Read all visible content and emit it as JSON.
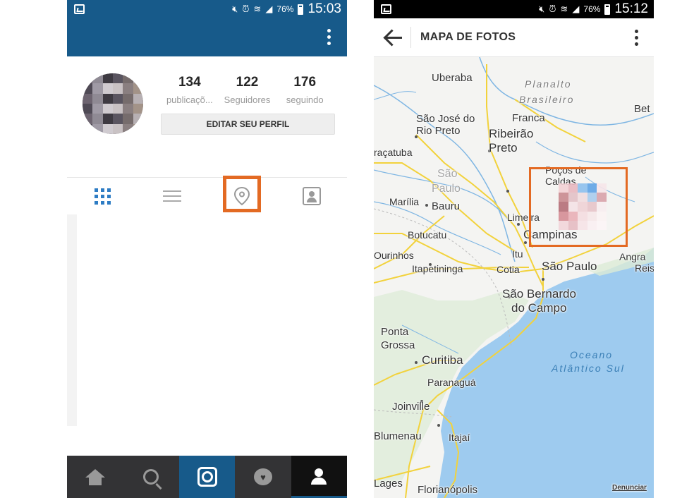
{
  "left_screen": {
    "status": {
      "battery": "76%",
      "time": "15:03"
    },
    "profile": {
      "stats": [
        {
          "value": "134",
          "label": "publicaçõ..."
        },
        {
          "value": "122",
          "label": "Seguidores"
        },
        {
          "value": "176",
          "label": "seguindo"
        }
      ],
      "edit_button": "EDITAR SEU PERFIL"
    },
    "tabs": [
      "grid-icon",
      "list-icon",
      "location-pin-icon",
      "tagged-photos-icon"
    ],
    "selected_tab": "location-pin-icon",
    "bottom_nav": [
      "home-icon",
      "search-icon",
      "camera-icon",
      "activity-icon",
      "profile-icon"
    ],
    "active_nav": "profile-icon",
    "colors": {
      "header": "#175a8a",
      "accent": "#2d7cc4",
      "highlight": "#e36a23"
    }
  },
  "right_screen": {
    "status": {
      "battery": "76%",
      "time": "15:12"
    },
    "title": "MAPA DE FOTOS",
    "map_labels": {
      "uberaba": "Uberaba",
      "planalto": "Planalto",
      "brasileiro": "Brasileiro",
      "franca": "Franca",
      "bet": "Bet",
      "sao_jose": "São José do",
      "rio_preto": "Rio Preto",
      "ribeirao": "Ribeirão",
      "preto": "Preto",
      "aracatuba": "raçatuba",
      "sao_paulo_state": "São",
      "paulo_state": "Paulo",
      "pocos": "Poços de",
      "caldas": "Caldas",
      "marilia": "Marília",
      "bauru": "Bauru",
      "limeira": "Limeira",
      "campinas": "Campinas",
      "botucatu": "Botucatu",
      "itu": "Itu",
      "ourinhos": "Ourinhos",
      "itapetininga": "Itapetininga",
      "cotia": "Cotia",
      "sao_paulo": "São Paulo",
      "angra": "Angra",
      "reis": "Reis",
      "sao_bernardo": "São Bernardo",
      "do_campo": "do Campo",
      "ponta": "Ponta",
      "grossa": "Grossa",
      "oceano": "Oceano",
      "atlantico": "Atlântico Sul",
      "curitiba": "Curitiba",
      "paranagua": "Paranaguá",
      "joinville": "Joinville",
      "blumenau": "Blumenau",
      "itajai": "Itajaí",
      "lages": "Lages",
      "florianopolis": "Florianópolis",
      "denunciar": "Denunciar"
    },
    "colors": {
      "ocean": "#9ecbef",
      "land": "#f4f4f2",
      "roads": "#f2d23c",
      "highlight": "#e36a23"
    }
  }
}
